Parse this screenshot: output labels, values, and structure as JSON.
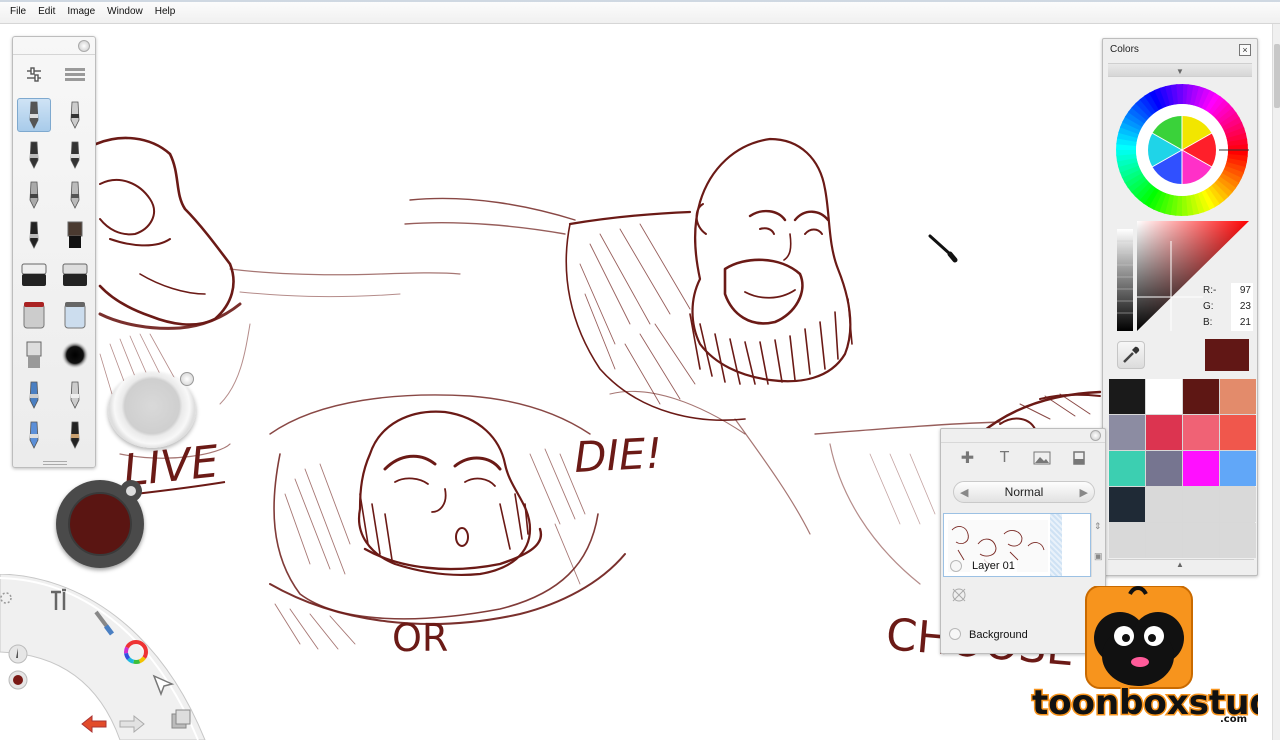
{
  "menu": {
    "file": "File",
    "edit": "Edit",
    "image": "Image",
    "window": "Window",
    "help": "Help"
  },
  "canvas": {
    "ink_color": "#6b1a16",
    "texts": {
      "live": "LIVE",
      "die": "DIE!",
      "or": "OR",
      "choose": "CHOOSE"
    }
  },
  "toolbox": {
    "tools": [
      "pencil-icon",
      "ballpoint-pen-icon",
      "marker-icon",
      "chisel-marker-icon",
      "fine-pen-icon",
      "brush-pen-icon",
      "ink-pen-icon",
      "paintbrush-icon",
      "eraser-icon",
      "soft-eraser-icon",
      "paint-bucket-icon",
      "multi-bucket-icon",
      "flat-brush-icon",
      "airbrush-icon",
      "blue-pencil-icon",
      "gray-pencil-icon",
      "blue-marker-icon",
      "dark-brush-icon"
    ]
  },
  "current_color": "#5a1512",
  "colors_panel": {
    "title": "Colors",
    "close": "×",
    "r_label": "R:-",
    "g_label": "G:",
    "b_label": "B:",
    "r": "97",
    "g": "23",
    "b": "21",
    "preview_color": "#611715",
    "swatches": [
      "#1a1a1a",
      "#ffffff",
      "#5e1714",
      "#e38b6b",
      "#8c8ca2",
      "#dc3450",
      "#f06275",
      "#f0574c",
      "#3ccfb1",
      "#767590",
      "#ff10ff",
      "#61a7f8",
      "#1f2a36",
      "#d9d9d9",
      "#d9d9d9",
      "#d9d9d9",
      "#d9d9d9",
      "#d9d9d9",
      "#d9d9d9",
      "#d9d9d9"
    ]
  },
  "layers": {
    "blend_mode": "Normal",
    "layer1_name": "Layer 01",
    "background_name": "Background"
  }
}
